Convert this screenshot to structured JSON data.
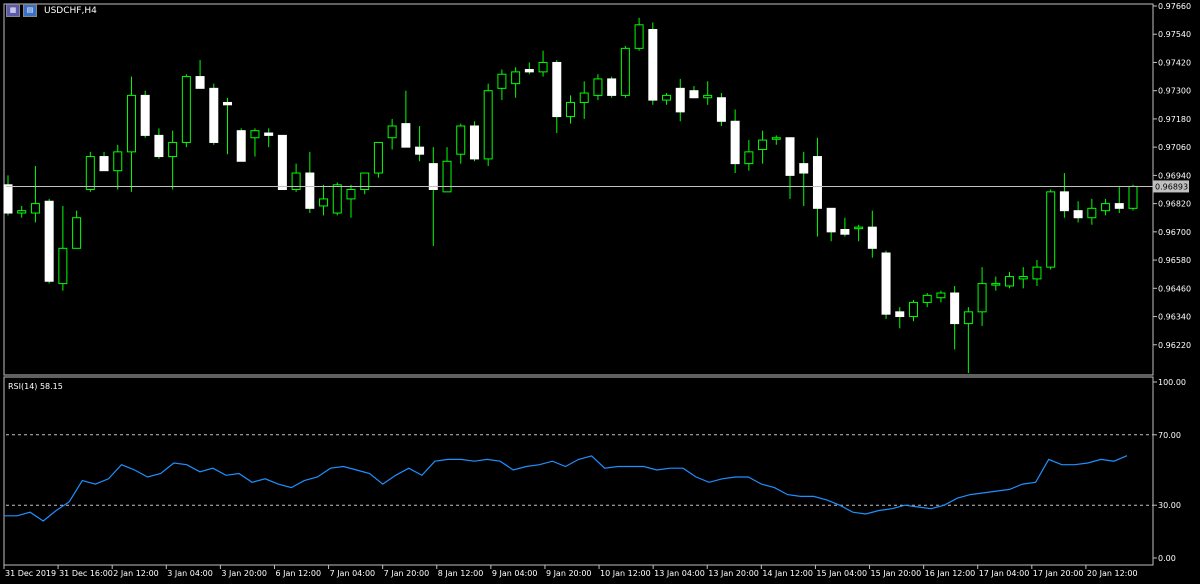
{
  "window": {
    "symbol_label": "USDCHF,H4",
    "icons": [
      "chart-window-icon",
      "chart-window-icon-2"
    ]
  },
  "colors": {
    "background": "#000000",
    "grid_line": "#ffffff",
    "bull_fill": "#000000",
    "bull_stroke": "#00ff00",
    "bear_fill": "#ffffff",
    "wick": "#00ff00",
    "rsi_line": "#1e90ff",
    "current_price_line": "#c0c0c0",
    "level_line": "#c0c0c0"
  },
  "chart_data": [
    {
      "type": "candlestick",
      "title": "USDCHF,H4",
      "ylim": [
        0.961,
        0.9766
      ],
      "y_ticks": [
        "0.97660",
        "0.97540",
        "0.97420",
        "0.97300",
        "0.97180",
        "0.97060",
        "0.96940",
        "0.96820",
        "0.96700",
        "0.96580",
        "0.96460",
        "0.96340",
        "0.96220"
      ],
      "current_price": "0.96893",
      "current_price_value": 0.96893,
      "grid": false,
      "candles": [
        {
          "o": 0.969,
          "h": 0.9694,
          "l": 0.9677,
          "c": 0.9678
        },
        {
          "o": 0.9678,
          "h": 0.9681,
          "l": 0.9676,
          "c": 0.9679
        },
        {
          "o": 0.9678,
          "h": 0.9698,
          "l": 0.9674,
          "c": 0.9682
        },
        {
          "o": 0.9683,
          "h": 0.9684,
          "l": 0.9648,
          "c": 0.9649
        },
        {
          "o": 0.9648,
          "h": 0.9681,
          "l": 0.9645,
          "c": 0.9663
        },
        {
          "o": 0.9663,
          "h": 0.9679,
          "l": 0.9663,
          "c": 0.9676
        },
        {
          "o": 0.9688,
          "h": 0.9704,
          "l": 0.9687,
          "c": 0.9702
        },
        {
          "o": 0.9702,
          "h": 0.9704,
          "l": 0.9696,
          "c": 0.9696
        },
        {
          "o": 0.9696,
          "h": 0.9707,
          "l": 0.9688,
          "c": 0.9704
        },
        {
          "o": 0.9704,
          "h": 0.9736,
          "l": 0.9687,
          "c": 0.9728
        },
        {
          "o": 0.9728,
          "h": 0.973,
          "l": 0.971,
          "c": 0.9711
        },
        {
          "o": 0.9711,
          "h": 0.9714,
          "l": 0.9701,
          "c": 0.9702
        },
        {
          "o": 0.9702,
          "h": 0.9713,
          "l": 0.9688,
          "c": 0.9708
        },
        {
          "o": 0.9708,
          "h": 0.9737,
          "l": 0.9706,
          "c": 0.9736
        },
        {
          "o": 0.9736,
          "h": 0.9743,
          "l": 0.9731,
          "c": 0.9731
        },
        {
          "o": 0.9731,
          "h": 0.9733,
          "l": 0.9707,
          "c": 0.9708
        },
        {
          "o": 0.9725,
          "h": 0.9727,
          "l": 0.9703,
          "c": 0.9724
        },
        {
          "o": 0.9713,
          "h": 0.9714,
          "l": 0.97,
          "c": 0.97
        },
        {
          "o": 0.971,
          "h": 0.9714,
          "l": 0.9702,
          "c": 0.9713
        },
        {
          "o": 0.9712,
          "h": 0.9714,
          "l": 0.9706,
          "c": 0.9711
        },
        {
          "o": 0.9711,
          "h": 0.9711,
          "l": 0.9688,
          "c": 0.9688
        },
        {
          "o": 0.9688,
          "h": 0.9699,
          "l": 0.9687,
          "c": 0.9695
        },
        {
          "o": 0.9695,
          "h": 0.9704,
          "l": 0.9678,
          "c": 0.968
        },
        {
          "o": 0.9681,
          "h": 0.969,
          "l": 0.9677,
          "c": 0.9684
        },
        {
          "o": 0.9678,
          "h": 0.9691,
          "l": 0.9677,
          "c": 0.969
        },
        {
          "o": 0.9684,
          "h": 0.969,
          "l": 0.9676,
          "c": 0.9688
        },
        {
          "o": 0.9688,
          "h": 0.9693,
          "l": 0.9686,
          "c": 0.9695
        },
        {
          "o": 0.9695,
          "h": 0.9705,
          "l": 0.9693,
          "c": 0.9708
        },
        {
          "o": 0.971,
          "h": 0.9718,
          "l": 0.9705,
          "c": 0.9715
        },
        {
          "o": 0.9716,
          "h": 0.973,
          "l": 0.9708,
          "c": 0.9706
        },
        {
          "o": 0.9706,
          "h": 0.9715,
          "l": 0.97,
          "c": 0.9703
        },
        {
          "o": 0.9699,
          "h": 0.9706,
          "l": 0.9664,
          "c": 0.9688
        },
        {
          "o": 0.9687,
          "h": 0.9706,
          "l": 0.9687,
          "c": 0.97
        },
        {
          "o": 0.9703,
          "h": 0.9716,
          "l": 0.9699,
          "c": 0.9715
        },
        {
          "o": 0.9715,
          "h": 0.9717,
          "l": 0.97,
          "c": 0.9701
        },
        {
          "o": 0.9701,
          "h": 0.9733,
          "l": 0.9698,
          "c": 0.973
        },
        {
          "o": 0.9731,
          "h": 0.9739,
          "l": 0.9726,
          "c": 0.9737
        },
        {
          "o": 0.9733,
          "h": 0.974,
          "l": 0.9727,
          "c": 0.9738
        },
        {
          "o": 0.9739,
          "h": 0.9742,
          "l": 0.9737,
          "c": 0.9738
        },
        {
          "o": 0.9738,
          "h": 0.9747,
          "l": 0.9736,
          "c": 0.9742
        },
        {
          "o": 0.9742,
          "h": 0.9743,
          "l": 0.9712,
          "c": 0.9719
        },
        {
          "o": 0.9719,
          "h": 0.9728,
          "l": 0.9716,
          "c": 0.9725
        },
        {
          "o": 0.9725,
          "h": 0.9734,
          "l": 0.9718,
          "c": 0.9729
        },
        {
          "o": 0.9728,
          "h": 0.9737,
          "l": 0.9726,
          "c": 0.9735
        },
        {
          "o": 0.9735,
          "h": 0.9736,
          "l": 0.9727,
          "c": 0.9728
        },
        {
          "o": 0.9728,
          "h": 0.9749,
          "l": 0.9727,
          "c": 0.9748
        },
        {
          "o": 0.9748,
          "h": 0.9761,
          "l": 0.9747,
          "c": 0.9758
        },
        {
          "o": 0.9756,
          "h": 0.9759,
          "l": 0.9724,
          "c": 0.9726
        },
        {
          "o": 0.9726,
          "h": 0.9729,
          "l": 0.9724,
          "c": 0.9728
        },
        {
          "o": 0.9731,
          "h": 0.9735,
          "l": 0.9717,
          "c": 0.9721
        },
        {
          "o": 0.973,
          "h": 0.9732,
          "l": 0.9727,
          "c": 0.9727
        },
        {
          "o": 0.9727,
          "h": 0.9734,
          "l": 0.9724,
          "c": 0.9728
        },
        {
          "o": 0.9727,
          "h": 0.9729,
          "l": 0.9715,
          "c": 0.9717
        },
        {
          "o": 0.9717,
          "h": 0.9722,
          "l": 0.9695,
          "c": 0.9699
        },
        {
          "o": 0.9699,
          "h": 0.9709,
          "l": 0.9696,
          "c": 0.9704
        },
        {
          "o": 0.9705,
          "h": 0.9713,
          "l": 0.9699,
          "c": 0.9709
        },
        {
          "o": 0.971,
          "h": 0.9711,
          "l": 0.9707,
          "c": 0.971
        },
        {
          "o": 0.971,
          "h": 0.971,
          "l": 0.9684,
          "c": 0.9694
        },
        {
          "o": 0.9699,
          "h": 0.9704,
          "l": 0.9681,
          "c": 0.9695
        },
        {
          "o": 0.9702,
          "h": 0.971,
          "l": 0.9668,
          "c": 0.968
        },
        {
          "o": 0.968,
          "h": 0.968,
          "l": 0.9666,
          "c": 0.967
        },
        {
          "o": 0.9671,
          "h": 0.9676,
          "l": 0.9668,
          "c": 0.9669
        },
        {
          "o": 0.9672,
          "h": 0.9673,
          "l": 0.9666,
          "c": 0.9672
        },
        {
          "o": 0.9672,
          "h": 0.9679,
          "l": 0.9659,
          "c": 0.9663
        },
        {
          "o": 0.9661,
          "h": 0.9662,
          "l": 0.9633,
          "c": 0.9635
        },
        {
          "o": 0.9636,
          "h": 0.9638,
          "l": 0.9629,
          "c": 0.9634
        },
        {
          "o": 0.9634,
          "h": 0.9641,
          "l": 0.9632,
          "c": 0.964
        },
        {
          "o": 0.964,
          "h": 0.9644,
          "l": 0.9638,
          "c": 0.9643
        },
        {
          "o": 0.9642,
          "h": 0.9645,
          "l": 0.964,
          "c": 0.9644
        },
        {
          "o": 0.9644,
          "h": 0.9647,
          "l": 0.962,
          "c": 0.9631
        },
        {
          "o": 0.9631,
          "h": 0.9638,
          "l": 0.961,
          "c": 0.9636
        },
        {
          "o": 0.9636,
          "h": 0.9655,
          "l": 0.963,
          "c": 0.9648
        },
        {
          "o": 0.9648,
          "h": 0.9651,
          "l": 0.9645,
          "c": 0.9648
        },
        {
          "o": 0.9647,
          "h": 0.9653,
          "l": 0.9646,
          "c": 0.9651
        },
        {
          "o": 0.965,
          "h": 0.9655,
          "l": 0.9646,
          "c": 0.9651
        },
        {
          "o": 0.965,
          "h": 0.9658,
          "l": 0.9647,
          "c": 0.9655
        },
        {
          "o": 0.9655,
          "h": 0.9688,
          "l": 0.9654,
          "c": 0.9687
        },
        {
          "o": 0.9687,
          "h": 0.9695,
          "l": 0.9676,
          "c": 0.9679
        },
        {
          "o": 0.9679,
          "h": 0.9683,
          "l": 0.9674,
          "c": 0.9676
        },
        {
          "o": 0.9676,
          "h": 0.9684,
          "l": 0.9673,
          "c": 0.968
        },
        {
          "o": 0.9679,
          "h": 0.9684,
          "l": 0.9677,
          "c": 0.9682
        },
        {
          "o": 0.9682,
          "h": 0.9689,
          "l": 0.9678,
          "c": 0.968
        },
        {
          "o": 0.968,
          "h": 0.969,
          "l": 0.9679,
          "c": 0.96893
        }
      ]
    },
    {
      "type": "line",
      "title": "RSI(14) 58.15",
      "ylim": [
        0,
        100
      ],
      "y_ticks": [
        "100.00",
        "70.00",
        "30.00",
        "0.00"
      ],
      "levels": [
        70,
        30
      ],
      "x_tick_labels": [
        "31 Dec 2019",
        "31 Dec 16:00",
        "2 Jan 12:00",
        "3 Jan 04:00",
        "3 Jan 20:00",
        "6 Jan 12:00",
        "7 Jan 04:00",
        "7 Jan 20:00",
        "8 Jan 12:00",
        "9 Jan 04:00",
        "9 Jan 20:00",
        "10 Jan 12:00",
        "13 Jan 04:00",
        "13 Jan 20:00",
        "14 Jan 12:00",
        "15 Jan 04:00",
        "15 Jan 20:00",
        "16 Jan 12:00",
        "17 Jan 04:00",
        "17 Jan 20:00",
        "20 Jan 12:00"
      ],
      "series": [
        {
          "name": "RSI(14)",
          "values": [
            24,
            24,
            26,
            21,
            27,
            32,
            44,
            42,
            45,
            53,
            50,
            46,
            48,
            54,
            53,
            49,
            51,
            47,
            48,
            43,
            45,
            42,
            40,
            44,
            46,
            51,
            52,
            50,
            48,
            42,
            47,
            51,
            47,
            55,
            56,
            56,
            55,
            56,
            55,
            50,
            52,
            53,
            55,
            52,
            56,
            58,
            51,
            52,
            52,
            52,
            50,
            51,
            51,
            46,
            43,
            45,
            46,
            46,
            42,
            40,
            36,
            35,
            35,
            33,
            30,
            26,
            25,
            27,
            28,
            30,
            29,
            28,
            30,
            34,
            36,
            37,
            38,
            39,
            42,
            43,
            56,
            53,
            53,
            54,
            56,
            55,
            58.15
          ]
        }
      ]
    }
  ]
}
